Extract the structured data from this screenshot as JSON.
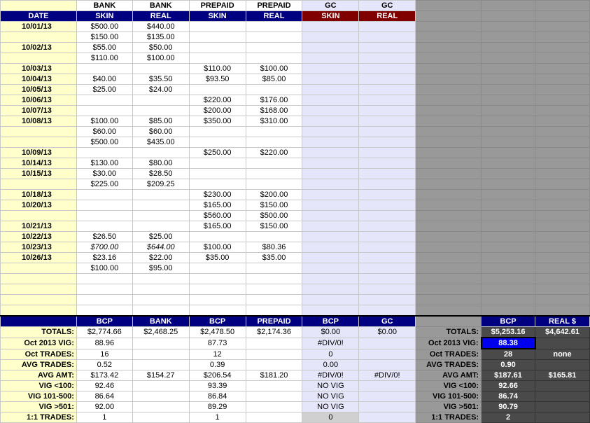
{
  "header": {
    "row1": [
      "",
      "BANK",
      "BANK",
      "PREPAID",
      "PREPAID",
      "GC",
      "GC"
    ],
    "row2": [
      "DATE",
      "SKIN",
      "REAL",
      "SKIN",
      "REAL",
      "SKIN",
      "REAL"
    ]
  },
  "rows": [
    {
      "date": "10/01/13",
      "bs": "$500.00",
      "br": "$440.00",
      "ps": "",
      "pr": ""
    },
    {
      "date": "",
      "bs": "$150.00",
      "br": "$135.00",
      "ps": "",
      "pr": ""
    },
    {
      "date": "10/02/13",
      "bs": "$55.00",
      "br": "$50.00",
      "ps": "",
      "pr": ""
    },
    {
      "date": "",
      "bs": "$110.00",
      "br": "$100.00",
      "ps": "",
      "pr": ""
    },
    {
      "date": "10/03/13",
      "bs": "",
      "br": "",
      "ps": "$110.00",
      "pr": "$100.00"
    },
    {
      "date": "10/04/13",
      "bs": "$40.00",
      "br": "$35.50",
      "ps": "$93.50",
      "pr": "$85.00"
    },
    {
      "date": "10/05/13",
      "bs": "$25.00",
      "br": "$24.00",
      "ps": "",
      "pr": ""
    },
    {
      "date": "10/06/13",
      "bs": "",
      "br": "",
      "ps": "$220.00",
      "pr": "$176.00"
    },
    {
      "date": "10/07/13",
      "bs": "",
      "br": "",
      "ps": "$200.00",
      "pr": "$168.00"
    },
    {
      "date": "10/08/13",
      "bs": "$100.00",
      "br": "$85.00",
      "ps": "$350.00",
      "pr": "$310.00"
    },
    {
      "date": "",
      "bs": "$60.00",
      "br": "$60.00",
      "ps": "",
      "pr": ""
    },
    {
      "date": "",
      "bs": "$500.00",
      "br": "$435.00",
      "ps": "",
      "pr": ""
    },
    {
      "date": "10/09/13",
      "bs": "",
      "br": "",
      "ps": "$250.00",
      "pr": "$220.00"
    },
    {
      "date": "10/14/13",
      "bs": "$130.00",
      "br": "$80.00",
      "ps": "",
      "pr": ""
    },
    {
      "date": "10/15/13",
      "bs": "$30.00",
      "br": "$28.50",
      "ps": "",
      "pr": ""
    },
    {
      "date": "",
      "bs": "$225.00",
      "br": "$209.25",
      "ps": "",
      "pr": ""
    },
    {
      "date": "10/18/13",
      "bs": "",
      "br": "",
      "ps": "$230.00",
      "pr": "$200.00"
    },
    {
      "date": "10/20/13",
      "bs": "",
      "br": "",
      "ps": "$165.00",
      "pr": "$150.00"
    },
    {
      "date": "",
      "bs": "",
      "br": "",
      "ps": "$560.00",
      "pr": "$500.00"
    },
    {
      "date": "10/21/13",
      "bs": "",
      "br": "",
      "ps": "$165.00",
      "pr": "$150.00"
    },
    {
      "date": "10/22/13",
      "bs": "$26.50",
      "br": "$25.00",
      "ps": "",
      "pr": ""
    },
    {
      "date": "10/23/13",
      "bs": "$700.00",
      "br": "$644.00",
      "ps": "$100.00",
      "pr": "$80.36",
      "italic": true
    },
    {
      "date": "10/26/13",
      "bs": "$23.16",
      "br": "$22.00",
      "ps": "$35.00",
      "pr": "$35.00"
    },
    {
      "date": "",
      "bs": "$100.00",
      "br": "$95.00",
      "ps": "",
      "pr": ""
    },
    {
      "date": "",
      "bs": "",
      "br": "",
      "ps": "",
      "pr": ""
    },
    {
      "date": "",
      "bs": "",
      "br": "",
      "ps": "",
      "pr": ""
    },
    {
      "date": "",
      "bs": "",
      "br": "",
      "ps": "",
      "pr": ""
    },
    {
      "date": "",
      "bs": "",
      "br": "",
      "ps": "",
      "pr": ""
    }
  ],
  "summary": {
    "head": [
      "BCP",
      "BANK",
      "BCP",
      "PREPAID",
      "BCP",
      "GC"
    ],
    "right_head": [
      "BCP",
      "REAL $"
    ],
    "rows": [
      {
        "label": "TOTALS:",
        "v": [
          "$2,774.66",
          "$2,468.25",
          "$2,478.50",
          "$2,174.36",
          "$0.00",
          "$0.00"
        ],
        "rlabel": "TOTALS:",
        "r": [
          "$5,253.16",
          "$4,642.61"
        ]
      },
      {
        "label": "Oct 2013 VIG:",
        "v": [
          "88.96",
          "",
          "87.73",
          "",
          "#DIV/0!",
          ""
        ],
        "rlabel": "Oct 2013 VIG:",
        "r": [
          "88.38",
          ""
        ]
      },
      {
        "label": "Oct TRADES:",
        "v": [
          "16",
          "",
          "12",
          "",
          "0",
          ""
        ],
        "rlabel": "Oct TRADES:",
        "r": [
          "28",
          "none"
        ]
      },
      {
        "label": "AVG TRADES:",
        "v": [
          "0.52",
          "",
          "0.39",
          "",
          "0.00",
          ""
        ],
        "rlabel": "AVG TRADES:",
        "r": [
          "0.90",
          ""
        ]
      },
      {
        "label": "AVG AMT:",
        "v": [
          "$173.42",
          "$154.27",
          "$206.54",
          "$181.20",
          "#DIV/0!",
          "#DIV/0!"
        ],
        "rlabel": "AVG AMT:",
        "r": [
          "$187.61",
          "$165.81"
        ]
      },
      {
        "label": "VIG <100:",
        "v": [
          "92.46",
          "",
          "93.39",
          "",
          "NO VIG",
          ""
        ],
        "rlabel": "VIG <100:",
        "r": [
          "92.66",
          ""
        ]
      },
      {
        "label": "VIG 101-500:",
        "v": [
          "86.64",
          "",
          "86.84",
          "",
          "NO VIG",
          ""
        ],
        "rlabel": "VIG 101-500:",
        "r": [
          "86.74",
          ""
        ]
      },
      {
        "label": "VIG >501:",
        "v": [
          "92.00",
          "",
          "89.29",
          "",
          "NO VIG",
          ""
        ],
        "rlabel": "VIG >501:",
        "r": [
          "90.79",
          ""
        ]
      },
      {
        "label": "1:1 TRADES:",
        "v": [
          "1",
          "",
          "1",
          "",
          "0",
          ""
        ],
        "rlabel": "1:1 TRADES:",
        "r": [
          "2",
          ""
        ]
      }
    ]
  }
}
